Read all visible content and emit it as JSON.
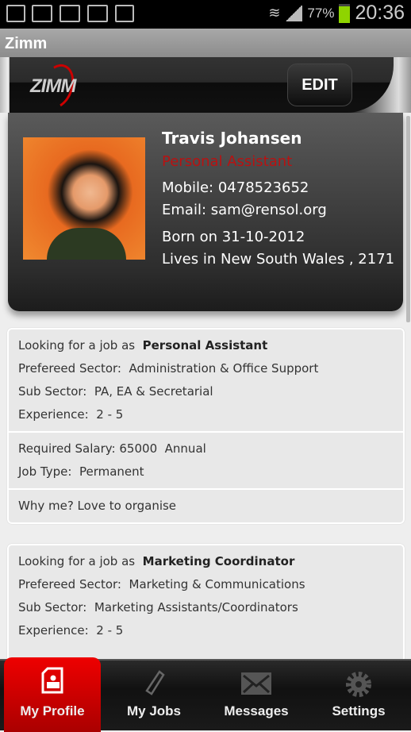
{
  "status_bar": {
    "battery": "77%",
    "time": "20:36",
    "icons": [
      "sim-icon",
      "gallery-icon",
      "gmail-icon",
      "email-icon",
      "play-store-icon",
      "wifi-icon",
      "signal-icon",
      "battery-icon"
    ]
  },
  "app_title": "Zimm",
  "header": {
    "logo": "ZIMM",
    "edit_label": "EDIT"
  },
  "profile": {
    "name": "Travis Johansen",
    "role": "Personal Assistant",
    "mobile": "Mobile: 0478523652",
    "email": "Email: sam@rensol.org",
    "born": "Born on 31-10-2012",
    "lives": "Lives in New South Wales , 2171",
    "accent": "#b81212"
  },
  "jobs": [
    {
      "looking_label": "Looking for a job as",
      "title": "Personal Assistant",
      "sector_label": "Prefereed Sector:",
      "sector": "Administration & Office Support",
      "sub_label": "Sub Sector:",
      "sub": "PA, EA & Secretarial",
      "exp_label": "Experience:",
      "exp": "2 - 5",
      "salary_label": "Required Salary:",
      "salary": "65000",
      "salary_period": "Annual",
      "type_label": "Job Type:",
      "type": "Permanent",
      "why": "Why me? Love to organise"
    },
    {
      "looking_label": "Looking for a job as",
      "title": "Marketing Coordinator",
      "sector_label": "Prefereed Sector:",
      "sector": "Marketing & Communications",
      "sub_label": "Sub Sector:",
      "sub": "Marketing Assistants/Coordinators",
      "exp_label": "Experience:",
      "exp": "2 - 5"
    }
  ],
  "tabs": [
    {
      "label": "My Profile",
      "icon": "profile-icon",
      "active": true
    },
    {
      "label": "My Jobs",
      "icon": "tie-icon"
    },
    {
      "label": "Messages",
      "icon": "envelope-icon"
    },
    {
      "label": "Settings",
      "icon": "gear-icon"
    }
  ]
}
